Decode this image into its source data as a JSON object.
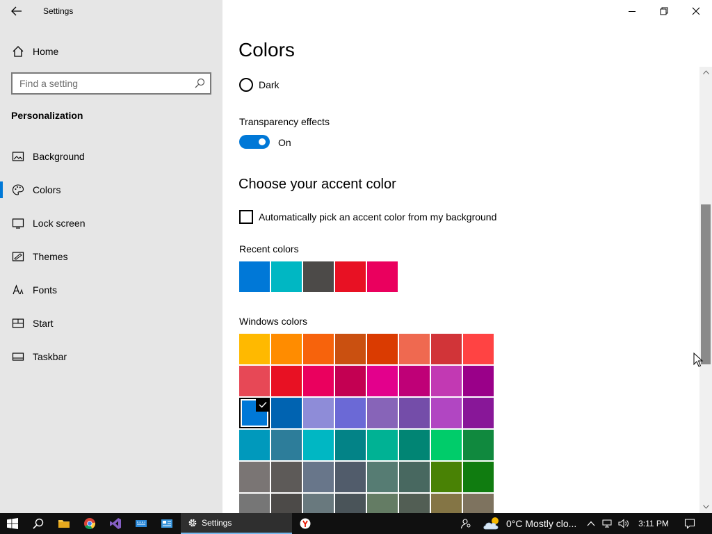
{
  "app": {
    "title": "Settings"
  },
  "sidebar": {
    "home_label": "Home",
    "search_placeholder": "Find a setting",
    "section": "Personalization",
    "items": [
      {
        "label": "Background",
        "icon": "picture-icon",
        "selected": false
      },
      {
        "label": "Colors",
        "icon": "palette-icon",
        "selected": true
      },
      {
        "label": "Lock screen",
        "icon": "lock-screen-icon",
        "selected": false
      },
      {
        "label": "Themes",
        "icon": "themes-icon",
        "selected": false
      },
      {
        "label": "Fonts",
        "icon": "fonts-icon",
        "selected": false
      },
      {
        "label": "Start",
        "icon": "start-icon",
        "selected": false
      },
      {
        "label": "Taskbar",
        "icon": "taskbar-icon",
        "selected": false
      }
    ]
  },
  "main": {
    "title": "Colors",
    "dark_option": "Dark",
    "transparency": {
      "label": "Transparency effects",
      "state": "On"
    },
    "accent_heading": "Choose your accent color",
    "auto_pick_label": "Automatically pick an accent color from my background",
    "recent_label": "Recent colors",
    "recent_colors": [
      "#0078d7",
      "#00b7c3",
      "#4c4a48",
      "#e81123",
      "#ea005e"
    ],
    "windows_label": "Windows colors",
    "windows_colors": [
      [
        "#ffb900",
        "#ff8c00",
        "#f7630c",
        "#ca5010",
        "#da3b01",
        "#ef6950",
        "#d13438",
        "#ff4343"
      ],
      [
        "#e74856",
        "#e81123",
        "#ea005e",
        "#c30052",
        "#e3008c",
        "#bf0077",
        "#c239b3",
        "#9a0089"
      ],
      [
        "#0078d7",
        "#0063b1",
        "#8e8cd8",
        "#6b69d6",
        "#8764b8",
        "#744da9",
        "#b146c2",
        "#881798"
      ],
      [
        "#0099bc",
        "#2d7d9a",
        "#00b7c3",
        "#038387",
        "#00b294",
        "#018574",
        "#00cc6a",
        "#10893e"
      ],
      [
        "#7a7574",
        "#5d5a58",
        "#68768a",
        "#515c6b",
        "#567c73",
        "#486860",
        "#498205",
        "#107c10"
      ],
      [
        "#767676",
        "#4c4a48",
        "#69797e",
        "#4a5459",
        "#647c64",
        "#525e54",
        "#847545",
        "#7e735f"
      ]
    ],
    "selected_color": "#0078d7"
  },
  "taskbar": {
    "active_app": "Settings",
    "weather": "0°C  Mostly clo...",
    "time": "3:11 PM"
  }
}
